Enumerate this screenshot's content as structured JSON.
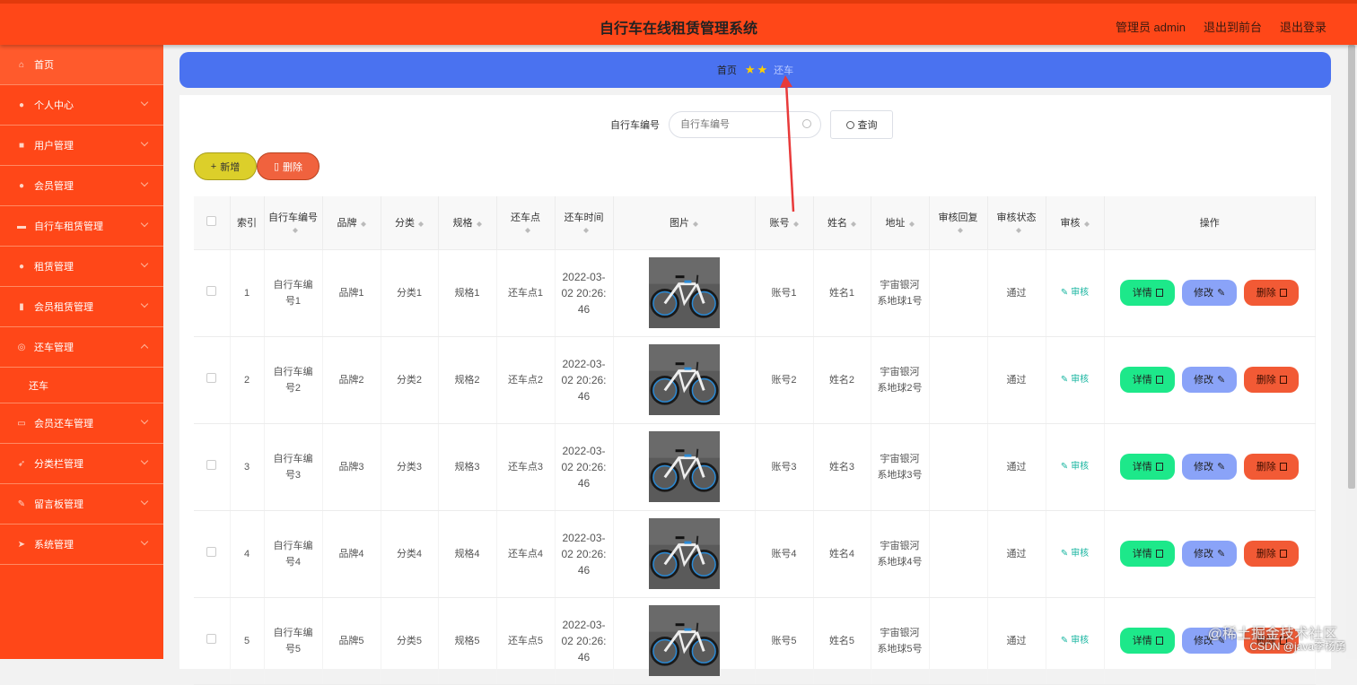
{
  "header": {
    "title": "自行车在线租赁管理系统",
    "user": "管理员 admin",
    "to_front": "退出到前台",
    "logout": "退出登录"
  },
  "sidebar": {
    "items": [
      {
        "label": "首页",
        "icon": "home-icon"
      },
      {
        "label": "个人中心",
        "icon": "user-icon"
      },
      {
        "label": "用户管理",
        "icon": "users-icon"
      },
      {
        "label": "会员管理",
        "icon": "member-icon"
      },
      {
        "label": "自行车租赁管理",
        "icon": "bike-icon"
      },
      {
        "label": "租赁管理",
        "icon": "rental-icon"
      },
      {
        "label": "会员租赁管理",
        "icon": "member-rental-icon"
      },
      {
        "label": "还车管理",
        "icon": "return-icon"
      },
      {
        "label": "会员还车管理",
        "icon": "member-return-icon"
      },
      {
        "label": "分类栏管理",
        "icon": "category-icon"
      },
      {
        "label": "留言板管理",
        "icon": "message-icon"
      },
      {
        "label": "系统管理",
        "icon": "system-icon"
      }
    ],
    "sub_item": "还车"
  },
  "breadcrumb": {
    "home": "首页",
    "current": "还车"
  },
  "search": {
    "label": "自行车编号",
    "placeholder": "自行车编号",
    "button": "查询"
  },
  "toolbar": {
    "add": "新增",
    "delete": "删除"
  },
  "table": {
    "headers": [
      "索引",
      "自行车编号",
      "品牌",
      "分类",
      "规格",
      "还车点",
      "还车时间",
      "图片",
      "账号",
      "姓名",
      "地址",
      "审核回复",
      "审核状态",
      "审核",
      "操作"
    ],
    "rows": [
      {
        "index": "1",
        "bike_no": "自行车编号1",
        "brand": "品牌1",
        "category": "分类1",
        "spec": "规格1",
        "point": "还车点1",
        "time": "2022-03-02 20:26:46",
        "account": "账号1",
        "name": "姓名1",
        "address": "宇宙银河系地球1号",
        "reply": "",
        "status": "通过",
        "audit": "审核"
      },
      {
        "index": "2",
        "bike_no": "自行车编号2",
        "brand": "品牌2",
        "category": "分类2",
        "spec": "规格2",
        "point": "还车点2",
        "time": "2022-03-02 20:26:46",
        "account": "账号2",
        "name": "姓名2",
        "address": "宇宙银河系地球2号",
        "reply": "",
        "status": "通过",
        "audit": "审核"
      },
      {
        "index": "3",
        "bike_no": "自行车编号3",
        "brand": "品牌3",
        "category": "分类3",
        "spec": "规格3",
        "point": "还车点3",
        "time": "2022-03-02 20:26:46",
        "account": "账号3",
        "name": "姓名3",
        "address": "宇宙银河系地球3号",
        "reply": "",
        "status": "通过",
        "audit": "审核"
      },
      {
        "index": "4",
        "bike_no": "自行车编号4",
        "brand": "品牌4",
        "category": "分类4",
        "spec": "规格4",
        "point": "还车点4",
        "time": "2022-03-02 20:26:46",
        "account": "账号4",
        "name": "姓名4",
        "address": "宇宙银河系地球4号",
        "reply": "",
        "status": "通过",
        "audit": "审核"
      },
      {
        "index": "5",
        "bike_no": "自行车编号5",
        "brand": "品牌5",
        "category": "分类5",
        "spec": "规格5",
        "point": "还车点5",
        "time": "2022-03-02 20:26:46",
        "account": "账号5",
        "name": "姓名5",
        "address": "宇宙银河系地球5号",
        "reply": "",
        "status": "通过",
        "audit": "审核"
      }
    ],
    "ops": {
      "detail": "详情",
      "edit": "修改",
      "delete": "删除"
    }
  },
  "watermark": {
    "line1": "@稀土掘金技术社区",
    "line2": "CSDN @java李杨勇"
  },
  "colors": {
    "header_bg": "#ff4718",
    "sidebar_bg": "#ff4718",
    "breadcrumb_bg": "#4a72f0",
    "detail_btn": "#1de88a",
    "edit_btn": "#8aa3f8",
    "delete_btn": "#f25a35",
    "add_btn": "#dccf2a",
    "annotation_arrow": "#e83a3a"
  }
}
